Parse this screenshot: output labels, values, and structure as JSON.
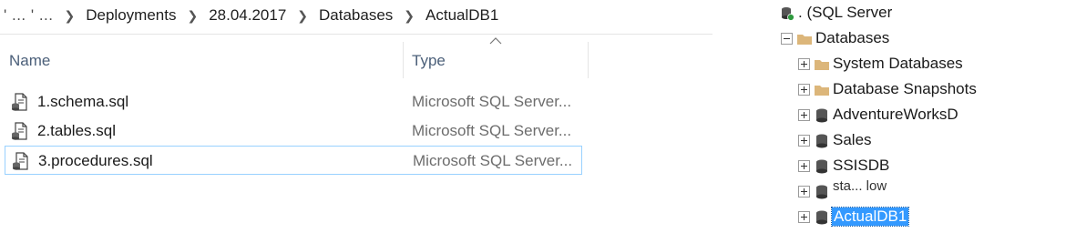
{
  "explorer": {
    "breadcrumb": {
      "obscured_segment": "' ... ' ... ",
      "items": [
        "Deployments",
        "28.04.2017",
        "Databases",
        "ActualDB1"
      ]
    },
    "columns": {
      "name": "Name",
      "type": "Type"
    },
    "files": [
      {
        "name": "1.schema.sql",
        "type": "Microsoft SQL Server...",
        "selected": false
      },
      {
        "name": "2.tables.sql",
        "type": "Microsoft SQL Server...",
        "selected": false
      },
      {
        "name": "3.procedures.sql",
        "type": "Microsoft SQL Server...",
        "selected": true
      }
    ]
  },
  "object_explorer": {
    "server": ". (SQL Server",
    "databases_folder": "Databases",
    "children": [
      {
        "label": "System Databases",
        "icon": "folder-icon"
      },
      {
        "label": "Database Snapshots",
        "icon": "folder-icon"
      },
      {
        "label": "AdventureWorksD",
        "icon": "database-icon"
      },
      {
        "label": "Sales",
        "icon": "database-icon"
      },
      {
        "label": "SSISDB",
        "icon": "database-icon"
      },
      {
        "label": "sta... low",
        "icon": "database-icon"
      },
      {
        "label": "ActualDB1",
        "icon": "database-icon",
        "selected": true
      }
    ]
  },
  "colors": {
    "selection_border": "#99d1ff",
    "tree_selection": "#3399ff",
    "header_text": "#4c607a",
    "folder": "#dcb67a"
  }
}
